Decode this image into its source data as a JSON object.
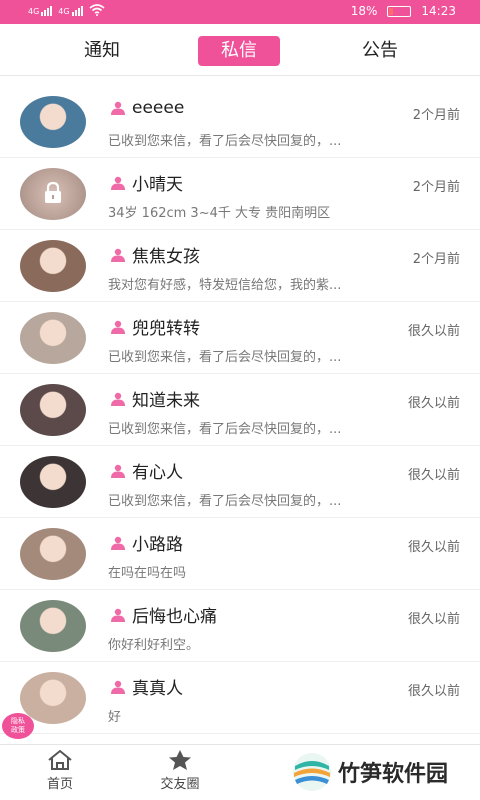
{
  "status_bar": {
    "network_1": "4G",
    "network_2": "4G",
    "battery": "18%",
    "time": "14:23"
  },
  "tabs": [
    {
      "label": "通知",
      "active": false
    },
    {
      "label": "私信",
      "active": true
    },
    {
      "label": "公告",
      "active": false
    }
  ],
  "messages": [
    {
      "name": "eeeee",
      "time": "2个月前",
      "preview": "已收到您来信，看了后会尽快回复的，...",
      "locked": false,
      "avatar_color": "#4a7a9c"
    },
    {
      "name": "小晴天",
      "time": "2个月前",
      "preview": "34岁 162cm 3~4千 大专 贵阳南明区",
      "locked": true,
      "avatar_color": "#c7a9a1"
    },
    {
      "name": "焦焦女孩",
      "time": "2个月前",
      "preview": "我对您有好感，特发短信给您，我的紫...",
      "locked": false,
      "avatar_color": "#8a6a5a"
    },
    {
      "name": "兜兜转转",
      "time": "很久以前",
      "preview": "已收到您来信，看了后会尽快回复的，...",
      "locked": false,
      "avatar_color": "#b8a79c"
    },
    {
      "name": "知道未来",
      "time": "很久以前",
      "preview": "已收到您来信，看了后会尽快回复的，...",
      "locked": false,
      "avatar_color": "#5c4a4a"
    },
    {
      "name": "有心人",
      "time": "很久以前",
      "preview": "已收到您来信，看了后会尽快回复的，...",
      "locked": false,
      "avatar_color": "#3d3535"
    },
    {
      "name": "小路路",
      "time": "很久以前",
      "preview": "在吗在吗在吗",
      "locked": false,
      "avatar_color": "#a48a7a"
    },
    {
      "name": "后悔也心痛",
      "time": "很久以前",
      "preview": "你好利好利空。",
      "locked": false,
      "avatar_color": "#7a8a7a"
    },
    {
      "name": "真真人",
      "time": "很久以前",
      "preview": "好",
      "locked": false,
      "avatar_color": "#c9b0a0"
    }
  ],
  "bottom_nav": [
    {
      "label": "首页",
      "icon": "home-icon"
    },
    {
      "label": "交友圈",
      "icon": "star-icon"
    }
  ],
  "privacy_badge": "隐私\n政策",
  "watermark": "竹笋软件园",
  "colors": {
    "accent": "#f0529a",
    "text": "#222222",
    "muted": "#777777"
  }
}
